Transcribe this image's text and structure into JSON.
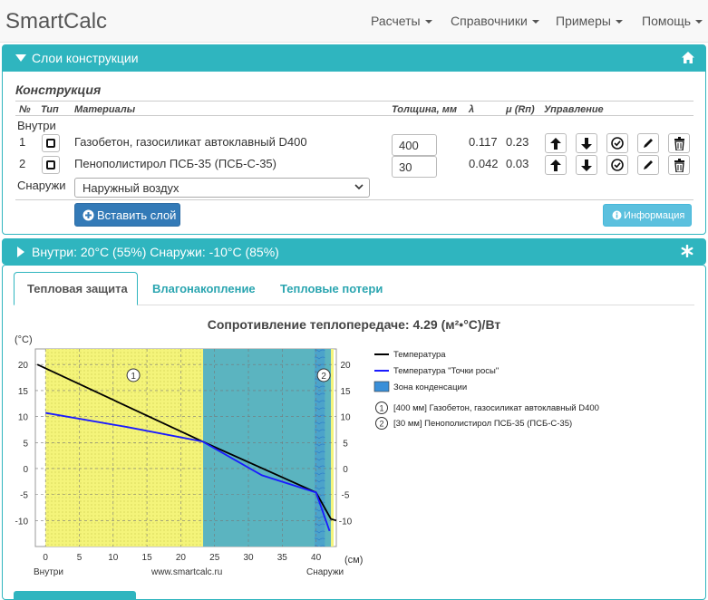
{
  "nav": {
    "brand": "SmartCalc",
    "items": [
      {
        "label": "Расчеты"
      },
      {
        "label": "Справочники"
      },
      {
        "label": "Примеры"
      },
      {
        "label": "Помощь"
      }
    ]
  },
  "layers_panel": {
    "title": "Слои конструкции",
    "section": "Конструкция",
    "headers": {
      "num": "№",
      "type": "Тип",
      "materials": "Материалы",
      "thickness": "Толщина, мм",
      "lambda": "λ",
      "mu": "μ (Rп)",
      "control": "Управление"
    },
    "inside_label": "Внутри",
    "outside_label": "Снаружи",
    "rows": [
      {
        "num": "1",
        "material": "Газобетон, газосиликат автоклавный D400",
        "thickness": "400",
        "lambda": "0.117",
        "mu": "0.23"
      },
      {
        "num": "2",
        "material": "Пенополистирол ПСБ-35 (ПСБ-С-35)",
        "thickness": "30",
        "lambda": "0.042",
        "mu": "0.03"
      }
    ],
    "outside_select": "Наружный воздух",
    "insert_button": "Вставить слой",
    "info_button": "Информация"
  },
  "climate_panel": {
    "title": "Внутри: 20°C (55%) Снаружи: -10°C (85%)"
  },
  "results": {
    "tabs": [
      {
        "label": "Тепловая защита",
        "active": true
      },
      {
        "label": "Влагонакопление",
        "active": false
      },
      {
        "label": "Тепловые потери",
        "active": false
      }
    ],
    "resistance_title": "Сопротивление теплопередаче: 4.29 (м²•°С)/Вт"
  },
  "chart_data": {
    "type": "line",
    "ylabel": "(°C)",
    "xlabel": "(см)",
    "xlim": [
      -1.5,
      43
    ],
    "ylim": [
      -15,
      23
    ],
    "x_ticks": [
      "0",
      "5",
      "10",
      "15",
      "20",
      "25",
      "30",
      "35",
      "40"
    ],
    "y_ticks": [
      "20",
      "15",
      "10",
      "5",
      "0",
      "-5",
      "-10"
    ],
    "y_tick_values": [
      20,
      15,
      10,
      5,
      0,
      -5,
      -10
    ],
    "x_tick_values": [
      0,
      5,
      10,
      15,
      20,
      25,
      30,
      35,
      40
    ],
    "bottom_labels": {
      "inside": "Внутри",
      "site": "www.smartcalc.ru",
      "outside": "Снаружи"
    },
    "layers": [
      {
        "marker": "1",
        "from": 0,
        "to": 23.3,
        "color": "#f4f47a"
      },
      {
        "marker": "2",
        "from": 23.3,
        "to": 42.2,
        "color": "#5bb4c0"
      }
    ],
    "condensation_zone": {
      "from": 39.8,
      "to": 41.3,
      "color": "#3a8fd8"
    },
    "series": [
      {
        "name": "Температура",
        "color": "#000000",
        "x": [
          -1.2,
          23.2,
          40.0,
          42.2,
          43.0
        ],
        "y": [
          20.0,
          5.2,
          -4.6,
          -9.7,
          -10.0
        ]
      },
      {
        "name": "Температура \"Точки росы\"",
        "color": "#1a1aff",
        "x": [
          0.0,
          12.0,
          23.2,
          32.0,
          40.0,
          42.0
        ],
        "y": [
          10.7,
          8.0,
          5.2,
          -1.3,
          -4.6,
          -12.0
        ]
      }
    ],
    "legend": [
      {
        "label": "Температура",
        "kind": "line",
        "color": "#000000"
      },
      {
        "label": "Температура \"Точки росы\"",
        "kind": "line",
        "color": "#1a1aff"
      },
      {
        "label": "Зона конденсации",
        "kind": "box",
        "color": "#3a8fd8"
      },
      {
        "label": "[400 мм] Газобетон, газосиликат автоклавный D400",
        "kind": "marker",
        "marker": "1"
      },
      {
        "label": "[30 мм] Пенополистирол ПСБ-35 (ПСБ-С-35)",
        "kind": "marker",
        "marker": "2"
      }
    ]
  }
}
